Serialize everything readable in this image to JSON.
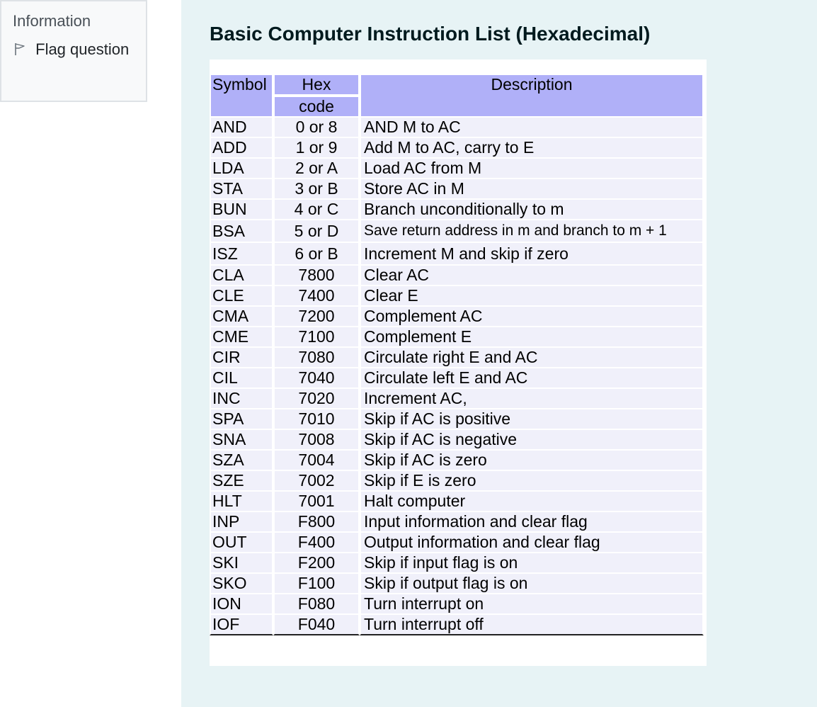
{
  "info": {
    "title": "Information",
    "flag_label": "Flag question"
  },
  "heading": "Basic Computer Instruction List (Hexadecimal)",
  "table": {
    "headers": {
      "symbol": "Symbol",
      "hex_line1": "Hex",
      "hex_line2": "code",
      "description": "Description"
    },
    "rows": [
      {
        "symbol": "AND",
        "hex": "0 or 8",
        "description": "AND M to AC"
      },
      {
        "symbol": "ADD",
        "hex": "1 or 9",
        "description": "Add M to AC, carry to E"
      },
      {
        "symbol": "LDA",
        "hex": "2 or A",
        "description": "Load  AC from  M"
      },
      {
        "symbol": "STA",
        "hex": "3 or B",
        "description": "Store  AC in M"
      },
      {
        "symbol": "BUN",
        "hex": "4 or C",
        "description": "Branch unconditionally  to m"
      },
      {
        "symbol": "BSA",
        "hex": "5 or D",
        "description": "Save return address in m and branch  to m + 1"
      },
      {
        "symbol": "ISZ",
        "hex": "6 or B",
        "description": "Increment M and skip if zero"
      },
      {
        "symbol": "CLA",
        "hex": "7800",
        "description": "Clear  AC"
      },
      {
        "symbol": "CLE",
        "hex": "7400",
        "description": "Clear E"
      },
      {
        "symbol": "CMA",
        "hex": "7200",
        "description": "Complement  AC"
      },
      {
        "symbol": "CME",
        "hex": "7100",
        "description": "Complement  E"
      },
      {
        "symbol": "CIR",
        "hex": "7080",
        "description": "Circulate right E and  AC"
      },
      {
        "symbol": "CIL",
        "hex": "7040",
        "description": "Circulate left E and  AC"
      },
      {
        "symbol": "INC",
        "hex": "7020",
        "description": "Increment  AC,"
      },
      {
        "symbol": "SPA",
        "hex": "7010",
        "description": "Skip if AC is positive"
      },
      {
        "symbol": "SNA",
        "hex": "7008",
        "description": "Skip if AC is negative"
      },
      {
        "symbol": "SZA",
        "hex": "7004",
        "description": "Skip if AC is zero"
      },
      {
        "symbol": "SZE",
        "hex": "7002",
        "description": "Skip if E is zero"
      },
      {
        "symbol": "HLT",
        "hex": "7001",
        "description": "Halt computer"
      },
      {
        "symbol": "INP",
        "hex": "F800",
        "description": "Input information and clear flag"
      },
      {
        "symbol": "OUT",
        "hex": "F400",
        "description": "Output  information  and clear flag"
      },
      {
        "symbol": "SKI",
        "hex": "F200",
        "description": "Skip if input flag is on"
      },
      {
        "symbol": "SKO",
        "hex": "F100",
        "description": "Skip if output  flag is on"
      },
      {
        "symbol": "ION",
        "hex": "F080",
        "description": "Turn  interrupt  on"
      },
      {
        "symbol": "IOF",
        "hex": "F040",
        "description": "Turn interrupt  off"
      }
    ]
  }
}
